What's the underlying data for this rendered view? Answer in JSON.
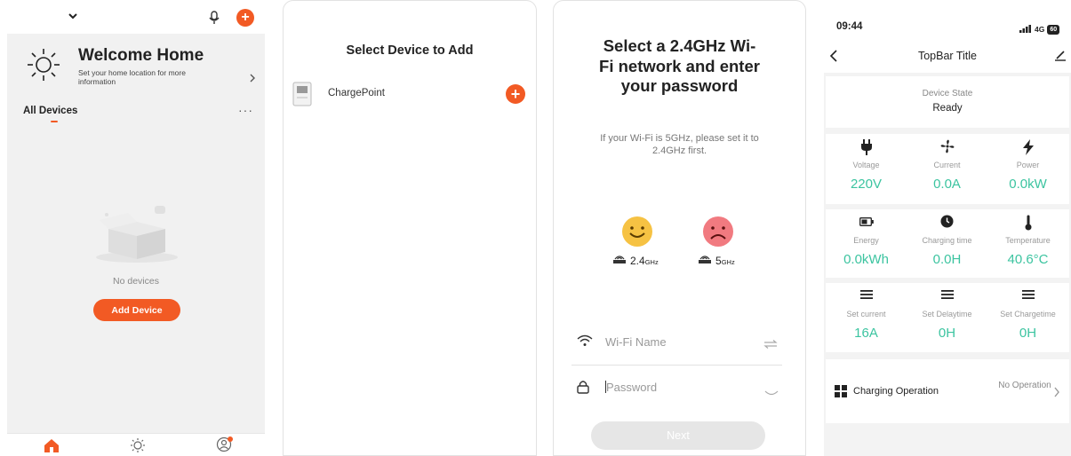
{
  "home": {
    "welcome_title": "Welcome Home",
    "welcome_subtitle": "Set your home location for more information",
    "all_devices": "All Devices",
    "more": "···",
    "empty_text": "No devices",
    "add_button": "Add Device"
  },
  "select_device": {
    "title": "Select Device to Add",
    "device_name": "ChargePoint"
  },
  "wifi": {
    "title": "Select a 2.4GHz Wi-Fi network and enter your password",
    "hint": "If your Wi-Fi is 5GHz, please set it to 2.4GHz first.",
    "band_24": "2.4",
    "band_24_unit": "GHz",
    "band_5": "5",
    "band_5_unit": "GHz",
    "wifi_placeholder": "Wi-Fi Name",
    "password_placeholder": "Password",
    "next": "Next"
  },
  "device": {
    "time": "09:44",
    "network": "4G",
    "battery": "60",
    "title": "TopBar Title",
    "state_label": "Device State",
    "state_value": "Ready",
    "metrics": [
      {
        "label": "Voltage",
        "value": "220V"
      },
      {
        "label": "Current",
        "value": "0.0A"
      },
      {
        "label": "Power",
        "value": "0.0kW"
      },
      {
        "label": "Energy",
        "value": "0.0kWh"
      },
      {
        "label": "Charging time",
        "value": "0.0H"
      },
      {
        "label": "Temperature",
        "value": "40.6°C"
      },
      {
        "label": "Set current",
        "value": "16A"
      },
      {
        "label": "Set Delaytime",
        "value": "0H"
      },
      {
        "label": "Set Chargetime",
        "value": "0H"
      }
    ],
    "operation_label": "Charging Operation",
    "operation_value": "No Operation"
  },
  "colors": {
    "accent": "#f25a24",
    "teal": "#3cc4a0"
  }
}
